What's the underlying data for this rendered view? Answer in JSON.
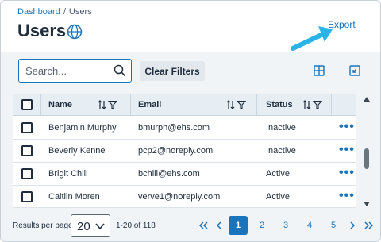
{
  "breadcrumb": {
    "root": "Dashboard",
    "separator": "/",
    "current": "Users"
  },
  "page": {
    "title": "Users",
    "export_label": "Export"
  },
  "toolbar": {
    "search_placeholder": "Search...",
    "clear_filters_label": "Clear Filters"
  },
  "table": {
    "columns": [
      {
        "key": "name",
        "label": "Name"
      },
      {
        "key": "email",
        "label": "Email"
      },
      {
        "key": "status",
        "label": "Status"
      }
    ],
    "rows": [
      {
        "name": "Benjamin Murphy",
        "email": "bmurph@ehs.com",
        "status": "Inactive"
      },
      {
        "name": "Beverly Kenne",
        "email": "pcp2@noreply.com",
        "status": "Inactive"
      },
      {
        "name": "Brigit Chill",
        "email": "bchill@ehs.com",
        "status": "Active"
      },
      {
        "name": "Caitlin Moren",
        "email": "verve1@noreply.com",
        "status": "Active"
      }
    ],
    "row_action_label": "•••"
  },
  "footer": {
    "rows_per_page_label": "Results per page",
    "rows_per_page_value": "20",
    "range_text": "1-20 of 118",
    "pages": [
      "1",
      "2",
      "3",
      "4",
      "5"
    ],
    "current_page": "1"
  },
  "colors": {
    "accent": "#1a74bb",
    "panel_bg": "#f1f4f7",
    "header_bg": "#e6eef4",
    "annotation_arrow": "#2ab3e6"
  }
}
